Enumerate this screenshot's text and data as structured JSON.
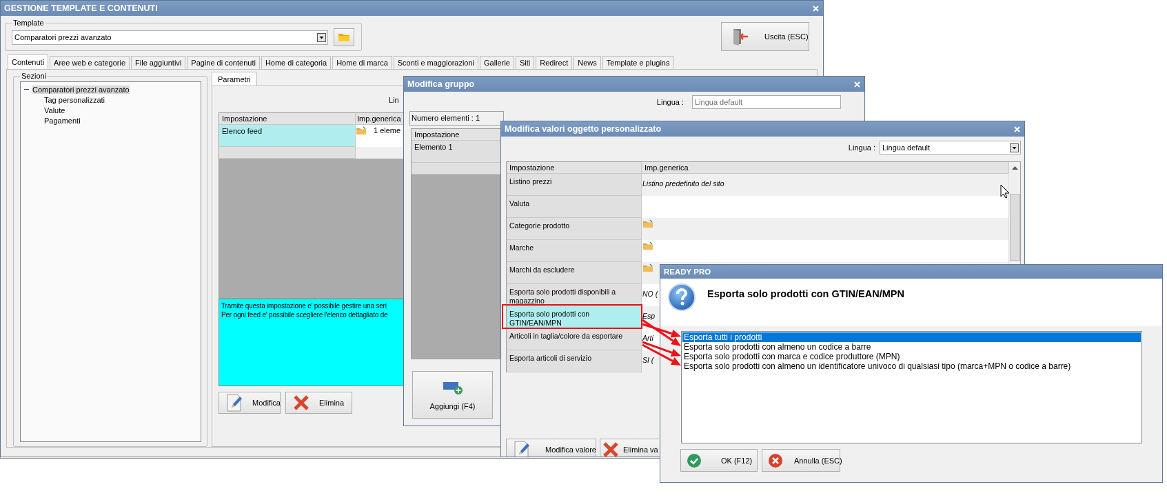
{
  "main_window": {
    "title": "GESTIONE TEMPLATE E CONTENUTI",
    "template": {
      "label": "Template",
      "value": "Comparatori prezzi avanzato"
    },
    "exit_button": "Uscita (ESC)",
    "tabs": [
      {
        "label": "Contenuti",
        "selected": true
      },
      {
        "label": "Aree web e categorie",
        "selected": false
      },
      {
        "label": "File aggiuntivi",
        "selected": false
      },
      {
        "label": "Pagine di contenuti",
        "selected": false
      },
      {
        "label": "Home di categoria",
        "selected": false
      },
      {
        "label": "Home di marca",
        "selected": false
      },
      {
        "label": "Sconti e maggiorazioni",
        "selected": false
      },
      {
        "label": "Gallerie",
        "selected": false
      },
      {
        "label": "Siti",
        "selected": false
      },
      {
        "label": "Redirect",
        "selected": false
      },
      {
        "label": "News",
        "selected": false
      },
      {
        "label": "Template e plugins",
        "selected": false
      }
    ],
    "sections": {
      "label": "Sezioni",
      "tree": [
        {
          "label": "Comparatori prezzi avanzato",
          "selected": true,
          "expanded": true,
          "children": [
            {
              "label": "Tag personalizzati",
              "selected": false
            },
            {
              "label": "Valute",
              "selected": false
            },
            {
              "label": "Pagamenti",
              "selected": false
            }
          ]
        }
      ]
    },
    "sub_tabs": [
      {
        "label": "Parametri",
        "selected": true
      }
    ],
    "language_label": "Lin",
    "table": {
      "columns": [
        "Impostazione",
        "Imp.generica"
      ],
      "rows": [
        {
          "setting": "Elenco feed",
          "kind": "folder",
          "value": "1 eleme",
          "selected": true
        }
      ]
    },
    "description": [
      "Tramite questa impostazione e' possibile gestire una seri",
      "Per ogni feed e' possibile scegliere l'elenco dettagliato de"
    ],
    "buttons": [
      "Modifica",
      "Elimina"
    ]
  },
  "group_window": {
    "title": "Modifica gruppo",
    "language_label": "Lingua :",
    "language_value": "Lingua default",
    "count": "Numero elementi : 1",
    "columns": [
      "Impostazione"
    ],
    "rows": [
      {
        "setting": "Elemento 1"
      }
    ],
    "add_button": "Aggiungi (F4)"
  },
  "values_window": {
    "title": "Modifica valori oggetto personalizzato",
    "language_label": "Lingua :",
    "language_value": "Lingua default",
    "columns": [
      "Impostazione",
      "Imp.generica"
    ],
    "rows": [
      {
        "setting": "Listino prezzi",
        "kind": "text",
        "value": "Listino predefinito del sito",
        "selected": false
      },
      {
        "setting": "Valuta",
        "kind": "text",
        "selected": false
      },
      {
        "setting": "Categorie prodotto",
        "kind": "folder",
        "selected": false
      },
      {
        "setting": "Marche",
        "kind": "folder",
        "selected": false
      },
      {
        "setting": "Marchi da escludere",
        "kind": "folder",
        "selected": false
      },
      {
        "setting": "Esporta solo prodotti disponibili a magazzino",
        "kind": "text",
        "value": "NO (",
        "selected": false
      },
      {
        "setting": "Esporta solo prodotti con GTIN/EAN/MPN",
        "kind": "text",
        "value": "Esp",
        "selected": true
      },
      {
        "setting": "Articoli in taglia/colore da esportare",
        "kind": "text",
        "value": "Arti",
        "selected": false
      },
      {
        "setting": "Esporta articoli di servizio",
        "kind": "text",
        "value": "SI (",
        "selected": false
      }
    ],
    "buttons": [
      "Modifica valore",
      "Elimina va"
    ]
  },
  "dialog": {
    "title": "READY PRO",
    "question": "Esporta solo prodotti con GTIN/EAN/MPN",
    "options": [
      {
        "label": "Esporta tutti i prodotti",
        "selected": true
      },
      {
        "label": "Esporta solo prodotti con almeno un codice a barre",
        "selected": false
      },
      {
        "label": "Esporta solo prodotti con marca e codice produttore (MPN)",
        "selected": false
      },
      {
        "label": "Esporta solo prodotti con almeno un identificatore univoco di qualsiasi tipo (marca+MPN o codice a barre)",
        "selected": false
      }
    ],
    "buttons": [
      "OK (F12)",
      "Annulla (ESC)"
    ]
  }
}
